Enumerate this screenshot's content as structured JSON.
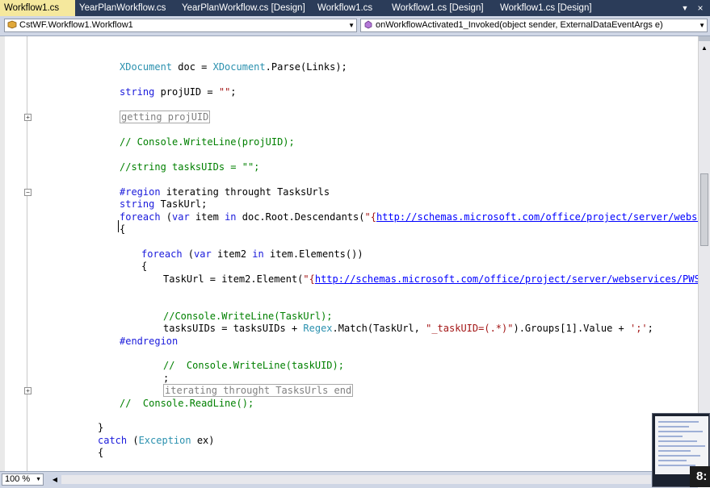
{
  "tabs": [
    {
      "label": "Workflow1.cs",
      "active": true
    },
    {
      "label": "YearPlanWorkflow.cs",
      "active": false
    },
    {
      "label": "YearPlanWorkflow.cs [Design]",
      "active": false
    },
    {
      "label": "Workflow1.cs",
      "active": false
    },
    {
      "label": "Workflow1.cs [Design]",
      "active": false
    },
    {
      "label": "Workflow1.cs [Design]",
      "active": false
    }
  ],
  "tab_close_glyph": "×",
  "navbar": {
    "class_selector": "CstWF.Workflow1.Workflow1",
    "member_selector": "onWorkflowActivated1_Invoked(object sender, ExternalDataEventArgs e)"
  },
  "code": {
    "l1_type": "XDocument",
    "l1_mid": " doc = ",
    "l1_type2": "XDocument",
    "l1_rest": ".Parse(Links);",
    "l2_kw": "string",
    "l2_mid": " projUID = ",
    "l2_str": "\"\"",
    "l2_end": ";",
    "l3_collapsed": "getting projUID",
    "l4_comment": "// Console.WriteLine(projUID);",
    "l5_comment": "//string tasksUIDs = \"\";",
    "l6_kw": "#region",
    "l6_rest": " iterating throught TasksUrls",
    "l7_kw": "string",
    "l7_rest": " TaskUrl;",
    "l8_kw": "foreach",
    "l8_a": " (",
    "l8_kw2": "var",
    "l8_b": " item ",
    "l8_kw3": "in",
    "l8_c": " doc.Root.Descendants(",
    "l8_str": "\"{",
    "l8_url": "http://schemas.microsoft.com/office/project/server/webservices/",
    "l9_text": "{",
    "l10_kw": "foreach",
    "l10_a": " (",
    "l10_kw2": "var",
    "l10_b": " item2 ",
    "l10_kw3": "in",
    "l10_c": " item.Elements())",
    "l11_text": "{",
    "l12_a": "TaskUrl = item2.Element(",
    "l12_str": "\"{",
    "l12_url": "http://schemas.microsoft.com/office/project/server/webservices/PWSLinkDat",
    "l13_comment": "//Console.WriteLine(TaskUrl);",
    "l14_a": "tasksUIDs = tasksUIDs + ",
    "l14_type": "Regex",
    "l14_b": ".Match(TaskUrl, ",
    "l14_str": "\"_taskUID=(.*)\"",
    "l14_c": ").Groups[1].Value + ",
    "l14_str2": "';'",
    "l14_d": ";",
    "l15_kw": "#endregion",
    "l16_comment": "//  Console.WriteLine(taskUID);",
    "l17_text": ";",
    "l18_collapsed": "iterating throught TasksUrls end",
    "l19_comment": "//  Console.ReadLine();",
    "l20_text": "}",
    "l21_kw": "catch",
    "l21_a": " (",
    "l21_type": "Exception",
    "l21_b": " ex)",
    "l22_text": "{"
  },
  "fold_markers": {
    "plus": "+",
    "minus": "−"
  },
  "zoom": "100 %",
  "video_timestamp": "8:",
  "colors": {
    "tabstrip_bg": "#2b3c59",
    "active_tab_bg": "#f5e89d",
    "keyword": "#1a1adb",
    "type": "#2b91af",
    "string": "#a31515",
    "comment": "#008000",
    "url": "#0000ff"
  }
}
